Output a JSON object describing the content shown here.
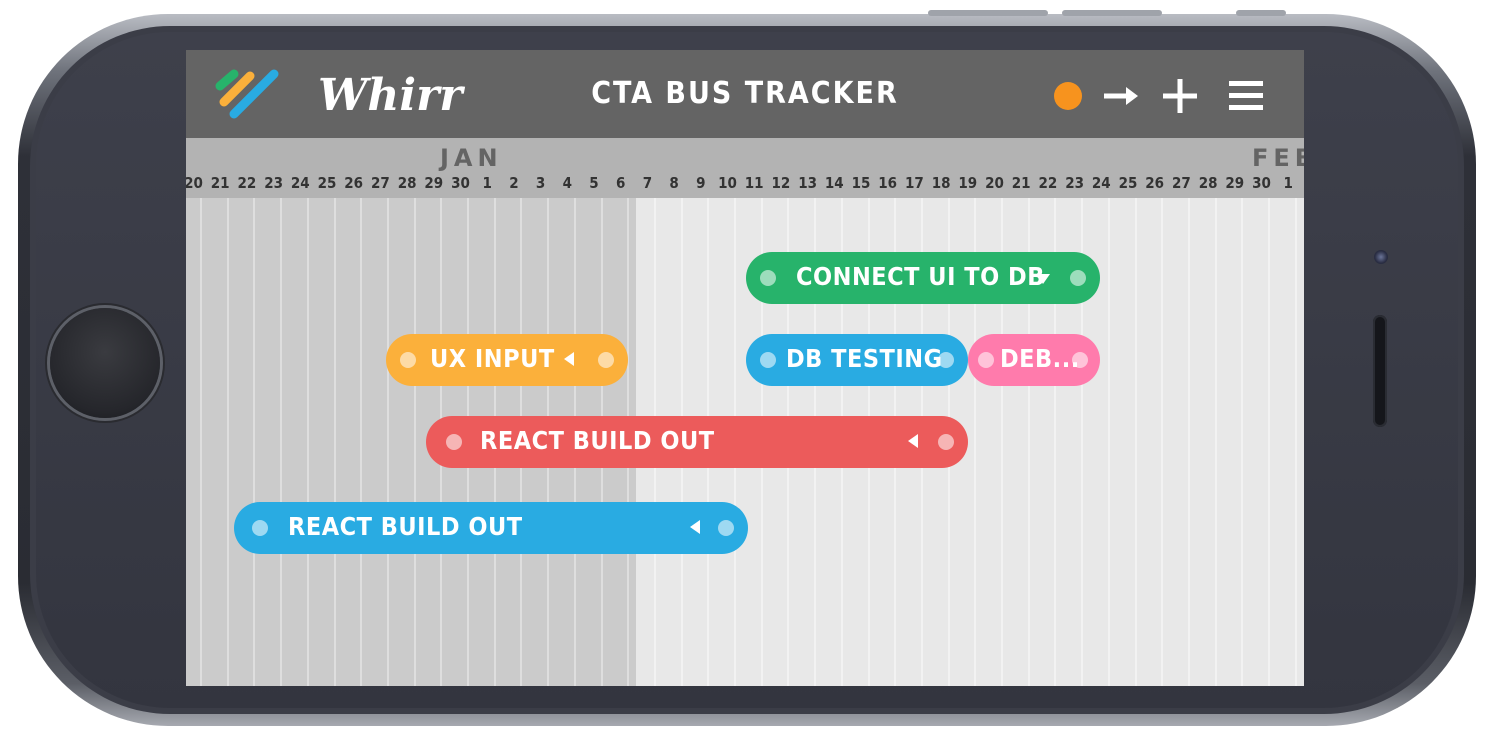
{
  "app": {
    "brand": "Whirr",
    "title": "CTA BUS TRACKER",
    "status_color": "#f7931e",
    "header_icons": [
      "status-dot",
      "arrow-right-icon",
      "plus-icon",
      "menu-icon"
    ]
  },
  "timeline": {
    "months": [
      {
        "label": "JAN"
      },
      {
        "label": "FEB"
      }
    ],
    "days": [
      "20",
      "21",
      "22",
      "23",
      "24",
      "25",
      "26",
      "27",
      "28",
      "29",
      "30",
      "1",
      "2",
      "3",
      "4",
      "5",
      "6",
      "7",
      "8",
      "9",
      "10",
      "11",
      "12",
      "13",
      "14",
      "15",
      "16",
      "17",
      "18",
      "19",
      "20",
      "21",
      "22",
      "23",
      "24",
      "25",
      "26",
      "27",
      "28",
      "29",
      "30",
      "1"
    ]
  },
  "tasks": [
    {
      "label": "CONNECT UI TO DB",
      "color": "#27b36b",
      "control": "chevron-down-icon"
    },
    {
      "label": "UX INPUT",
      "color": "#fbb03b",
      "control": "chevron-left-icon"
    },
    {
      "label": "DB TESTING",
      "color": "#29abe2",
      "control": ""
    },
    {
      "label": "DEB...",
      "color": "#ff7bac",
      "control": ""
    },
    {
      "label": "REACT BUILD OUT",
      "color": "#ec5b5b",
      "control": "chevron-left-icon"
    },
    {
      "label": "REACT BUILD OUT",
      "color": "#29abe2",
      "control": "chevron-left-icon"
    }
  ]
}
